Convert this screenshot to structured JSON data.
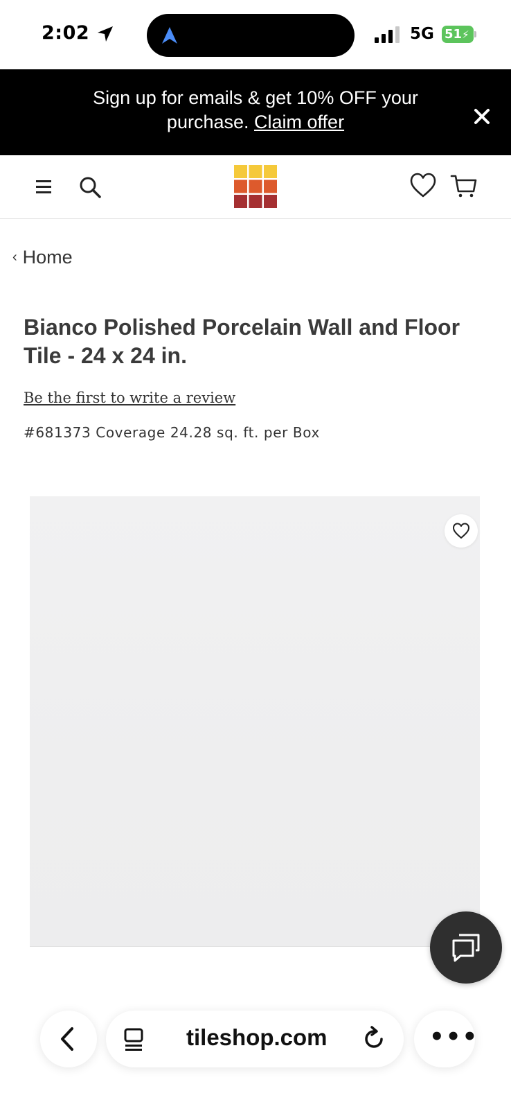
{
  "status_bar": {
    "time": "2:02",
    "network": "5G",
    "battery": "51"
  },
  "promo": {
    "text": "Sign up for emails & get 10% OFF your purchase.",
    "link_label": "Claim offer"
  },
  "header": {
    "icons": [
      "menu-icon",
      "search-icon",
      "logo",
      "heart-icon",
      "cart-icon"
    ],
    "logo_colors": [
      "#f5c93a",
      "#f5c93a",
      "#f5c93a",
      "#dd5a2c",
      "#dd5a2c",
      "#dd5a2c",
      "#a52f31",
      "#a52f31",
      "#a52f31"
    ]
  },
  "breadcrumb": {
    "label": "Home"
  },
  "product": {
    "title": "Bianco Polished Porcelain Wall and Floor Tile - 24 x 24 in.",
    "review_link": "Be the first to write a review",
    "sku_line": "#681373 Coverage 24.28 sq. ft. per Box"
  },
  "browser": {
    "url": "tileshop.com",
    "more": "•••"
  }
}
